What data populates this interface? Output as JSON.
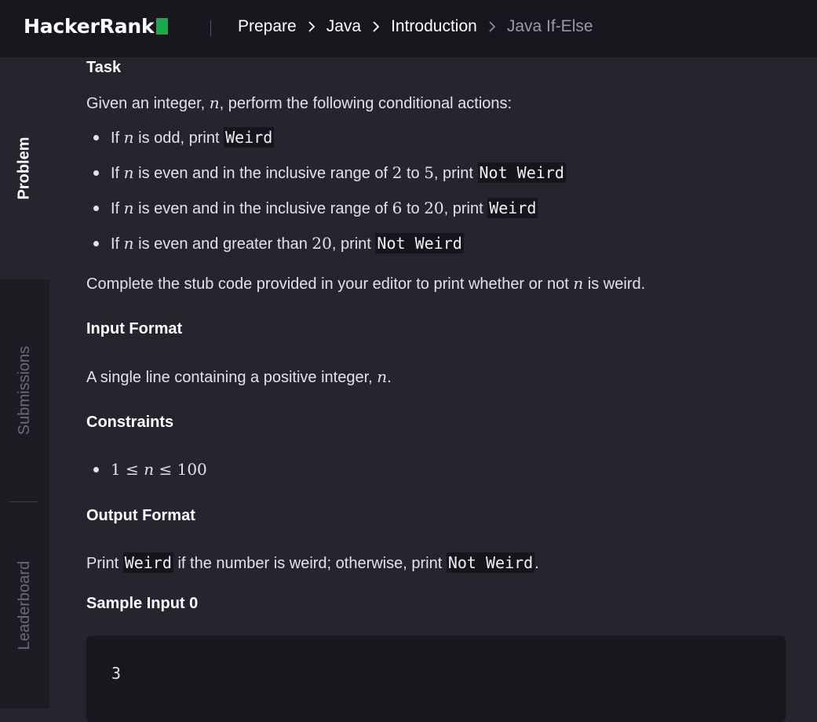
{
  "brand": {
    "name": "HackerRank"
  },
  "breadcrumb": {
    "items": [
      "Prepare",
      "Java",
      "Introduction",
      "Java If-Else"
    ]
  },
  "sidenav": {
    "tabs": [
      "Problem",
      "Submissions",
      "Leaderboard"
    ],
    "active": "Problem"
  },
  "problem": {
    "task_heading": "Task",
    "intro": {
      "a": "Given an integer, ",
      "var": "n",
      "b": ", perform the following conditional actions:"
    },
    "rules": [
      {
        "a": "If ",
        "var": "n",
        "b": " is odd, print ",
        "code": "Weird"
      },
      {
        "a": "If ",
        "var": "n",
        "b": " is even and in the inclusive range of ",
        "n1": "2",
        "c": " to ",
        "n2": "5",
        "d": ", print ",
        "code": "Not Weird"
      },
      {
        "a": "If ",
        "var": "n",
        "b": " is even and in the inclusive range of ",
        "n1": "6",
        "c": " to ",
        "n2": "20",
        "d": ", print ",
        "code": "Weird"
      },
      {
        "a": "If ",
        "var": "n",
        "b": " is even and greater than ",
        "n1": "20",
        "d": ", print ",
        "code": "Not Weird"
      }
    ],
    "complete": {
      "a": "Complete the stub code provided in your editor to print whether or not ",
      "var": "n",
      "b": " is weird."
    },
    "input_heading": "Input Format",
    "input_text": {
      "a": "A single line containing a positive integer, ",
      "var": "n",
      "b": "."
    },
    "constraints_heading": "Constraints",
    "constraint": {
      "lo": "1",
      "le1": " ≤ ",
      "var": "n",
      "le2": " ≤ ",
      "hi": "100"
    },
    "output_heading": "Output Format",
    "output_text": {
      "a": "Print ",
      "code1": "Weird",
      "b": " if the number is weird; otherwise, print ",
      "code2": "Not Weird",
      "c": "."
    },
    "sample_heading": "Sample Input 0",
    "sample_input": "3"
  }
}
